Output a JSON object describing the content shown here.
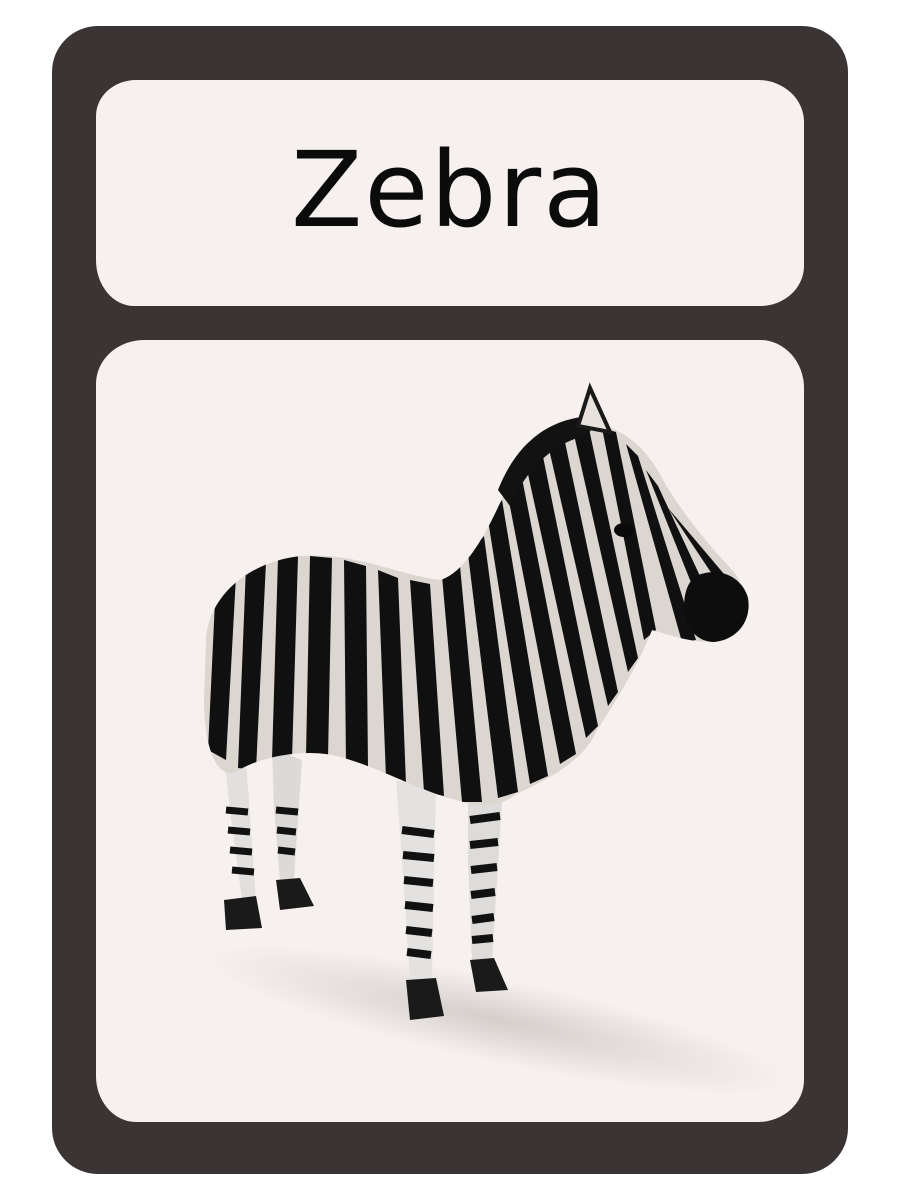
{
  "card": {
    "title": "Zebra",
    "frame_color": "#3a3434",
    "panel_color": "#f6f1ee",
    "illustration": "zebra-illustration"
  }
}
